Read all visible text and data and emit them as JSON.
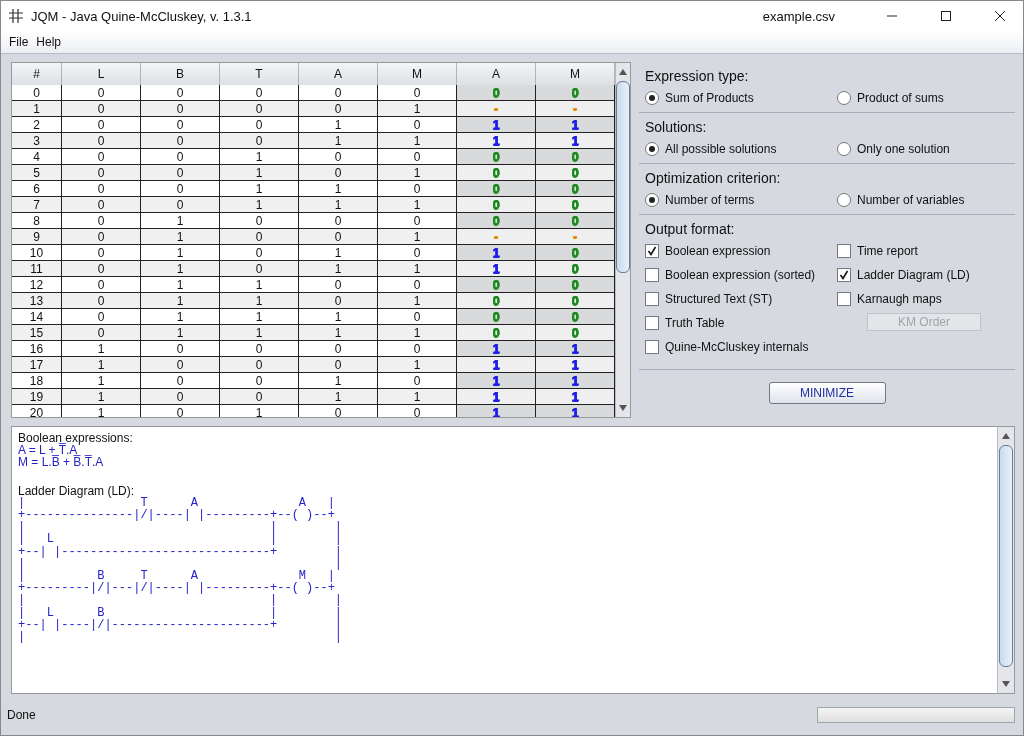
{
  "window": {
    "title": "JQM - Java Quine-McCluskey, v. 1.3.1",
    "file": "example.csv"
  },
  "menu": [
    "File",
    "Help"
  ],
  "table": {
    "columns": [
      "#",
      "L",
      "B",
      "T",
      "A",
      "M"
    ],
    "output_columns": [
      "A",
      "M"
    ],
    "rows": [
      {
        "cells": [
          "0",
          "0",
          "0",
          "0",
          "0",
          "0"
        ],
        "outputs": [
          {
            "text": "0",
            "color": "#1e8c1e"
          },
          {
            "text": "0",
            "color": "#1e8c1e"
          }
        ]
      },
      {
        "cells": [
          "1",
          "0",
          "0",
          "0",
          "0",
          "1"
        ],
        "outputs": [
          {
            "text": "-",
            "color": "#e08a00"
          },
          {
            "text": "-",
            "color": "#e08a00"
          }
        ]
      },
      {
        "cells": [
          "2",
          "0",
          "0",
          "0",
          "1",
          "0"
        ],
        "outputs": [
          {
            "text": "1",
            "color": "#2020e0"
          },
          {
            "text": "1",
            "color": "#2020e0"
          }
        ]
      },
      {
        "cells": [
          "3",
          "0",
          "0",
          "0",
          "1",
          "1"
        ],
        "outputs": [
          {
            "text": "1",
            "color": "#2020e0"
          },
          {
            "text": "1",
            "color": "#2020e0"
          }
        ]
      },
      {
        "cells": [
          "4",
          "0",
          "0",
          "1",
          "0",
          "0"
        ],
        "outputs": [
          {
            "text": "0",
            "color": "#1e8c1e"
          },
          {
            "text": "0",
            "color": "#1e8c1e"
          }
        ]
      },
      {
        "cells": [
          "5",
          "0",
          "0",
          "1",
          "0",
          "1"
        ],
        "outputs": [
          {
            "text": "0",
            "color": "#1e8c1e"
          },
          {
            "text": "0",
            "color": "#1e8c1e"
          }
        ]
      },
      {
        "cells": [
          "6",
          "0",
          "0",
          "1",
          "1",
          "0"
        ],
        "outputs": [
          {
            "text": "0",
            "color": "#1e8c1e"
          },
          {
            "text": "0",
            "color": "#1e8c1e"
          }
        ]
      },
      {
        "cells": [
          "7",
          "0",
          "0",
          "1",
          "1",
          "1"
        ],
        "outputs": [
          {
            "text": "0",
            "color": "#1e8c1e"
          },
          {
            "text": "0",
            "color": "#1e8c1e"
          }
        ]
      },
      {
        "cells": [
          "8",
          "0",
          "1",
          "0",
          "0",
          "0"
        ],
        "outputs": [
          {
            "text": "0",
            "color": "#1e8c1e"
          },
          {
            "text": "0",
            "color": "#1e8c1e"
          }
        ]
      },
      {
        "cells": [
          "9",
          "0",
          "1",
          "0",
          "0",
          "1"
        ],
        "outputs": [
          {
            "text": "-",
            "color": "#e08a00"
          },
          {
            "text": "-",
            "color": "#e08a00"
          }
        ]
      },
      {
        "cells": [
          "10",
          "0",
          "1",
          "0",
          "1",
          "0"
        ],
        "outputs": [
          {
            "text": "1",
            "color": "#2020e0"
          },
          {
            "text": "0",
            "color": "#1e8c1e"
          }
        ]
      },
      {
        "cells": [
          "11",
          "0",
          "1",
          "0",
          "1",
          "1"
        ],
        "outputs": [
          {
            "text": "1",
            "color": "#2020e0"
          },
          {
            "text": "0",
            "color": "#1e8c1e"
          }
        ]
      },
      {
        "cells": [
          "12",
          "0",
          "1",
          "1",
          "0",
          "0"
        ],
        "outputs": [
          {
            "text": "0",
            "color": "#1e8c1e"
          },
          {
            "text": "0",
            "color": "#1e8c1e"
          }
        ]
      },
      {
        "cells": [
          "13",
          "0",
          "1",
          "1",
          "0",
          "1"
        ],
        "outputs": [
          {
            "text": "0",
            "color": "#1e8c1e"
          },
          {
            "text": "0",
            "color": "#1e8c1e"
          }
        ]
      },
      {
        "cells": [
          "14",
          "0",
          "1",
          "1",
          "1",
          "0"
        ],
        "outputs": [
          {
            "text": "0",
            "color": "#1e8c1e"
          },
          {
            "text": "0",
            "color": "#1e8c1e"
          }
        ]
      },
      {
        "cells": [
          "15",
          "0",
          "1",
          "1",
          "1",
          "1"
        ],
        "outputs": [
          {
            "text": "0",
            "color": "#1e8c1e"
          },
          {
            "text": "0",
            "color": "#1e8c1e"
          }
        ]
      },
      {
        "cells": [
          "16",
          "1",
          "0",
          "0",
          "0",
          "0"
        ],
        "outputs": [
          {
            "text": "1",
            "color": "#2020e0"
          },
          {
            "text": "1",
            "color": "#2020e0"
          }
        ]
      },
      {
        "cells": [
          "17",
          "1",
          "0",
          "0",
          "0",
          "1"
        ],
        "outputs": [
          {
            "text": "1",
            "color": "#2020e0"
          },
          {
            "text": "1",
            "color": "#2020e0"
          }
        ]
      },
      {
        "cells": [
          "18",
          "1",
          "0",
          "0",
          "1",
          "0"
        ],
        "outputs": [
          {
            "text": "1",
            "color": "#2020e0"
          },
          {
            "text": "1",
            "color": "#2020e0"
          }
        ]
      },
      {
        "cells": [
          "19",
          "1",
          "0",
          "0",
          "1",
          "1"
        ],
        "outputs": [
          {
            "text": "1",
            "color": "#2020e0"
          },
          {
            "text": "1",
            "color": "#2020e0"
          }
        ]
      },
      {
        "cells": [
          "20",
          "1",
          "0",
          "1",
          "0",
          "0"
        ],
        "outputs": [
          {
            "text": "1",
            "color": "#2020e0"
          },
          {
            "text": "1",
            "color": "#2020e0"
          }
        ]
      }
    ]
  },
  "options": {
    "groups": [
      {
        "title": "Expression type:",
        "choices": [
          {
            "label": "Sum of Products",
            "selected": true
          },
          {
            "label": "Product of sums",
            "selected": false
          }
        ]
      },
      {
        "title": "Solutions:",
        "choices": [
          {
            "label": "All possible solutions",
            "selected": true
          },
          {
            "label": "Only one solution",
            "selected": false
          }
        ]
      },
      {
        "title": "Optimization criterion:",
        "choices": [
          {
            "label": "Number of terms",
            "selected": true
          },
          {
            "label": "Number of variables",
            "selected": false
          }
        ]
      }
    ],
    "output_format": {
      "title": "Output format:",
      "items": [
        {
          "kind": "checkbox",
          "label": "Boolean expression",
          "checked": true
        },
        {
          "kind": "checkbox",
          "label": "Time report",
          "checked": false
        },
        {
          "kind": "checkbox",
          "label": "Boolean expression (sorted)",
          "checked": false
        },
        {
          "kind": "checkbox",
          "label": "Ladder Diagram (LD)",
          "checked": true
        },
        {
          "kind": "checkbox",
          "label": "Structured Text (ST)",
          "checked": false
        },
        {
          "kind": "checkbox",
          "label": "Karnaugh maps",
          "checked": false
        },
        {
          "kind": "checkbox",
          "label": "Truth Table",
          "checked": false
        },
        {
          "kind": "button",
          "label": "KM Order",
          "disabled": true
        },
        {
          "kind": "checkbox",
          "label": "Quine-McCluskey internals",
          "checked": false
        }
      ]
    },
    "minimize": "MINIMIZE"
  },
  "output": [
    {
      "kind": "heading",
      "text": "Boolean expressions:"
    },
    {
      "kind": "expr",
      "text": "A = L + T̅.A"
    },
    {
      "kind": "expr",
      "text": "M = L.B̅ + B̅.T̅.A"
    },
    {
      "kind": "blank"
    },
    {
      "kind": "heading",
      "text": "Ladder Diagram (LD):"
    },
    {
      "kind": "ladder",
      "text": "|                T      A              A   |"
    },
    {
      "kind": "ladder",
      "text": "+---------------|/|----| |---------+--( )--+"
    },
    {
      "kind": "ladder",
      "text": "|                                  |        |"
    },
    {
      "kind": "ladder",
      "text": "|   L                              |        |"
    },
    {
      "kind": "ladder",
      "text": "+--| |-----------------------------+        |"
    },
    {
      "kind": "ladder",
      "text": "|                                           |"
    },
    {
      "kind": "ladder",
      "text": "|          B     T      A              M   |"
    },
    {
      "kind": "ladder",
      "text": "+---------|/|---|/|----| |---------+--( )--+"
    },
    {
      "kind": "ladder",
      "text": "|                                  |        |"
    },
    {
      "kind": "ladder",
      "text": "|   L      B                       |        |"
    },
    {
      "kind": "ladder",
      "text": "+--| |----|/|----------------------+        |"
    },
    {
      "kind": "ladder",
      "text": "|                                           |"
    }
  ],
  "status": "Done",
  "progress": {
    "level": 0
  }
}
